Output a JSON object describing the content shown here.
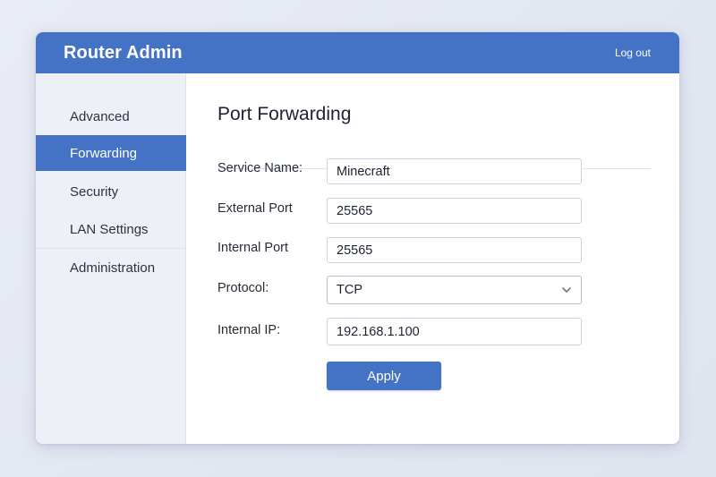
{
  "header": {
    "title": "Router Admin",
    "logout_label": "Log out"
  },
  "sidebar": {
    "items": [
      {
        "label": "Advanced",
        "active": false
      },
      {
        "label": "Forwarding",
        "active": true
      },
      {
        "label": "Security",
        "active": false
      },
      {
        "label": "LAN Settings",
        "active": false
      },
      {
        "label": "Administration",
        "active": false
      }
    ]
  },
  "main": {
    "title": "Port Forwarding",
    "form": {
      "service_name": {
        "label": "Service Name:",
        "value": "Minecraft"
      },
      "external_port": {
        "label": "External Port",
        "value": "25565"
      },
      "internal_port": {
        "label": "Internal Port",
        "value": "25565"
      },
      "protocol": {
        "label": "Protocol:",
        "value": "TCP",
        "icon": "chevron-down-icon"
      },
      "internal_ip": {
        "label": "Internal IP:",
        "value": "192.168.1.100"
      }
    },
    "apply_label": "Apply"
  },
  "colors": {
    "accent": "#4472c4",
    "sidebar_bg": "#edf0f7",
    "page_bg": "#e6e9f2"
  }
}
